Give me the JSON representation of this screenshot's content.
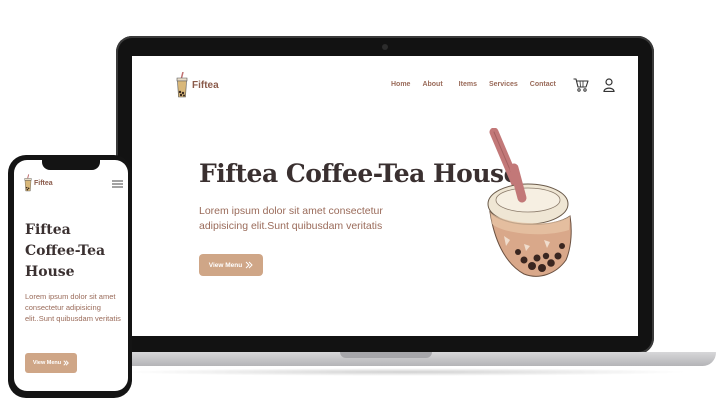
{
  "brand": {
    "name": "Fiftea",
    "accent": "#cfa687",
    "text_brown": "#9a6b5a"
  },
  "desktop": {
    "nav": [
      "Home",
      "About",
      "Items",
      "Services",
      "Contact"
    ],
    "title": "Fiftea Coffee-Tea House",
    "description": "Lorem ipsum dolor sit amet consectetur adipisicing elit.Sunt quibusdam veritatis",
    "button_label": "View Menu",
    "icons": [
      "cart-icon",
      "user-icon"
    ]
  },
  "mobile": {
    "title": "Fiftea Coffee-Tea House",
    "description": "Lorem ipsum dolor sit amet consectetur adipisicing elit..Sunt quibusdam veritatis",
    "button_label": "View Menu",
    "icons": [
      "hamburger-menu-icon"
    ]
  }
}
